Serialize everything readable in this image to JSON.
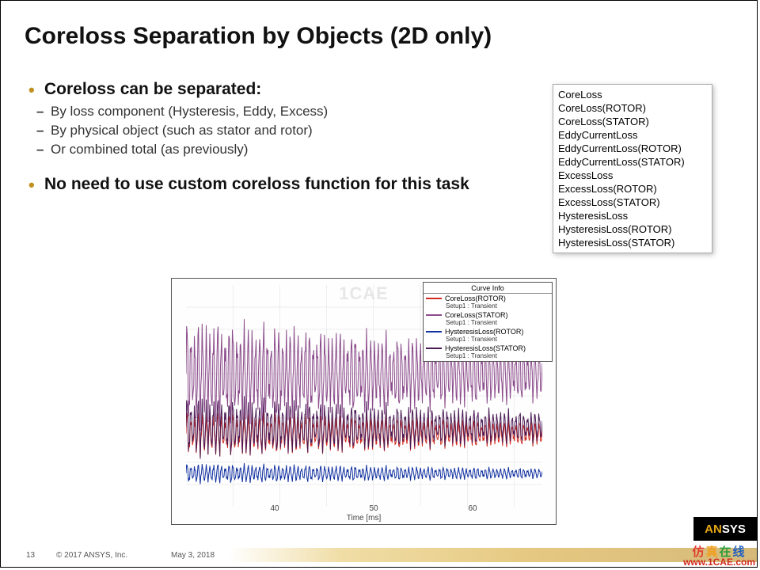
{
  "title": "Coreloss Separation by Objects (2D only)",
  "bullets": {
    "b1": "Coreloss can be separated:",
    "b1a": "By loss component (Hysteresis, Eddy, Excess)",
    "b1b": "By physical object (such as stator and rotor)",
    "b1c": "Or combined total (as previously)",
    "b2": "No need to use custom coreloss function for this task"
  },
  "listbox": {
    "items": [
      "CoreLoss",
      "CoreLoss(ROTOR)",
      "CoreLoss(STATOR)",
      "EddyCurrentLoss",
      "EddyCurrentLoss(ROTOR)",
      "EddyCurrentLoss(STATOR)",
      "ExcessLoss",
      "ExcessLoss(ROTOR)",
      "ExcessLoss(STATOR)",
      "HysteresisLoss",
      "HysteresisLoss(ROTOR)",
      "HysteresisLoss(STATOR)"
    ]
  },
  "chart_data": {
    "type": "line",
    "title": "",
    "xlabel": "Time [ms]",
    "ylabel": "",
    "xlim": [
      30,
      68
    ],
    "ylim": [
      0,
      100
    ],
    "xticks": [
      40,
      50,
      60
    ],
    "watermark": "1CAE",
    "legend_title": "Curve Info",
    "setup_caption": "Setup1 : Transient",
    "series": [
      {
        "name": "CoreLoss(ROTOR)",
        "color": "#d02b1f",
        "mean": 33,
        "amp": 7,
        "freq": 28
      },
      {
        "name": "CoreLoss(STATOR)",
        "color": "#8a4a8a",
        "mean": 60,
        "amp": 16,
        "freq": 28
      },
      {
        "name": "HysteresisLoss(ROTOR)",
        "color": "#1030a0",
        "mean": 15,
        "amp": 3,
        "freq": 28
      },
      {
        "name": "HysteresisLoss(STATOR)",
        "color": "#4a1a55",
        "mean": 36,
        "amp": 9,
        "freq": 28
      }
    ]
  },
  "footer": {
    "page": "13",
    "copyright": "© 2017 ANSYS, Inc.",
    "date": "May 3, 2018",
    "logo": "ANSYS",
    "cae_cn": "仿真在线",
    "cae_url": "www.1CAE.com"
  }
}
